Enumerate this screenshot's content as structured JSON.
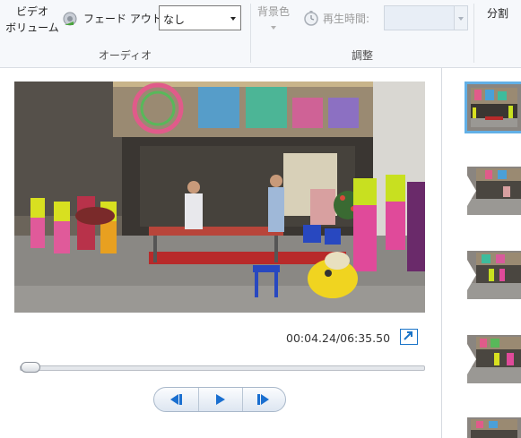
{
  "ribbon": {
    "audio": {
      "video_volume_label_line1": "ビデオ",
      "video_volume_label_line2": "ボリューム",
      "fade_out_label": "フェード アウト:",
      "fade_out_value": "なし",
      "group_label": "オーディオ"
    },
    "adjust": {
      "background_color_label": "背景色",
      "duration_label": "再生時間:",
      "duration_value": "",
      "group_label": "調整"
    },
    "split": {
      "label": "分割"
    }
  },
  "preview": {
    "time_readout": "00:04.24/06:35.50",
    "seek_position_fraction": 0.011
  },
  "storyboard": {
    "selected_index": 0,
    "clip_count_visible": 5
  },
  "colors": {
    "accent": "#1a74c8",
    "selection": "#62b0e6",
    "ribbon_bg": "#f6f8fb"
  },
  "icons": {
    "fade_out": "speaker-fade-icon",
    "duration": "clock-icon",
    "expand": "expand-arrow-icon",
    "prev": "previous-frame-icon",
    "play": "play-icon",
    "next": "next-frame-icon"
  }
}
